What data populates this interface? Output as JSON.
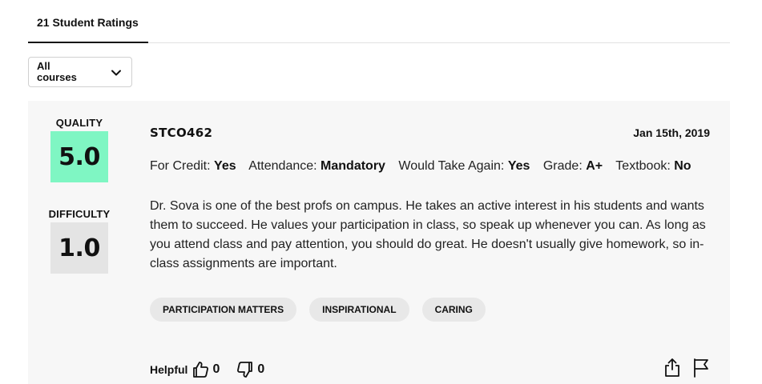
{
  "tabs": {
    "active_label": "21 Student Ratings"
  },
  "course_filter": {
    "selected": "All courses"
  },
  "rating": {
    "quality_label": "QUALITY",
    "quality_score": "5.0",
    "difficulty_label": "DIFFICULTY",
    "difficulty_score": "1.0",
    "course_code": "STCO462",
    "date": "Jan 15th, 2019",
    "meta": [
      {
        "label": "For Credit:",
        "value": "Yes"
      },
      {
        "label": "Attendance:",
        "value": "Mandatory"
      },
      {
        "label": "Would Take Again:",
        "value": "Yes"
      },
      {
        "label": "Grade:",
        "value": "A+"
      },
      {
        "label": "Textbook:",
        "value": "No"
      }
    ],
    "comment": "Dr. Sova is one of the best profs on campus. He takes an active interest in his students and wants them to succeed. He values your participation in class, so speak up whenever you can. As long as you attend class and pay attention, you should do great. He doesn't usually give homework, so in-class assignments are important.",
    "tags": [
      "PARTICIPATION MATTERS",
      "INSPIRATIONAL",
      "CARING"
    ],
    "helpful_label": "Helpful",
    "thumbs_up_count": "0",
    "thumbs_down_count": "0"
  },
  "icons": {
    "chevron": "chevron-down-icon",
    "thumbs_up": "thumbs-up-icon",
    "thumbs_down": "thumbs-down-icon",
    "share": "share-icon",
    "flag": "flag-icon"
  },
  "colors": {
    "quality_bg": "#7ff6c3",
    "difficulty_bg": "#e4e4e4",
    "card_bg": "#f7f7f7"
  }
}
